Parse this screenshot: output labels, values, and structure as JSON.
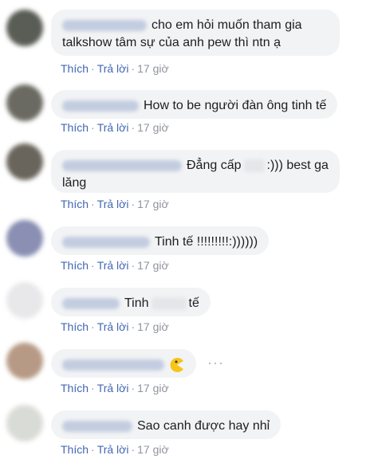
{
  "comments": [
    {
      "text1": "cho em hỏi muốn tham gia",
      "text2": "talkshow tâm sự của anh pew thì ntn ạ",
      "like": "Thích",
      "reply": "Trả lời",
      "time": "17 giờ",
      "avatar_color": "#5a5d55"
    },
    {
      "text1": "How to be người đàn ông tinh tế",
      "like": "Thích",
      "reply": "Trả lời",
      "time": "17 giờ",
      "avatar_color": "#6b6a62"
    },
    {
      "text1a": "Đẳng cấp",
      "text1b": ":))) best ga",
      "text2": "lăng",
      "like": "Thích",
      "reply": "Trả lời",
      "time": "17 giờ",
      "avatar_color": "#6a655c"
    },
    {
      "text1": "Tinh tế !!!!!!!!!:))))))",
      "like": "Thích",
      "reply": "Trả lời",
      "time": "17 giờ",
      "avatar_color": "#8a8fb3"
    },
    {
      "text1a": "Tinh",
      "text1b": "tế",
      "like": "Thích",
      "reply": "Trả lời",
      "time": "17 giờ",
      "avatar_color": "#e8e8ea"
    },
    {
      "like": "Thích",
      "reply": "Trả lời",
      "time": "17 giờ",
      "avatar_color": "#b79a86",
      "more": "···",
      "emoji": "pacman-emoji"
    },
    {
      "text1": "Sao canh được hay nhỉ",
      "like": "Thích",
      "reply": "Trả lời",
      "time": "17 giờ",
      "avatar_color": "#d9dcd6"
    }
  ]
}
